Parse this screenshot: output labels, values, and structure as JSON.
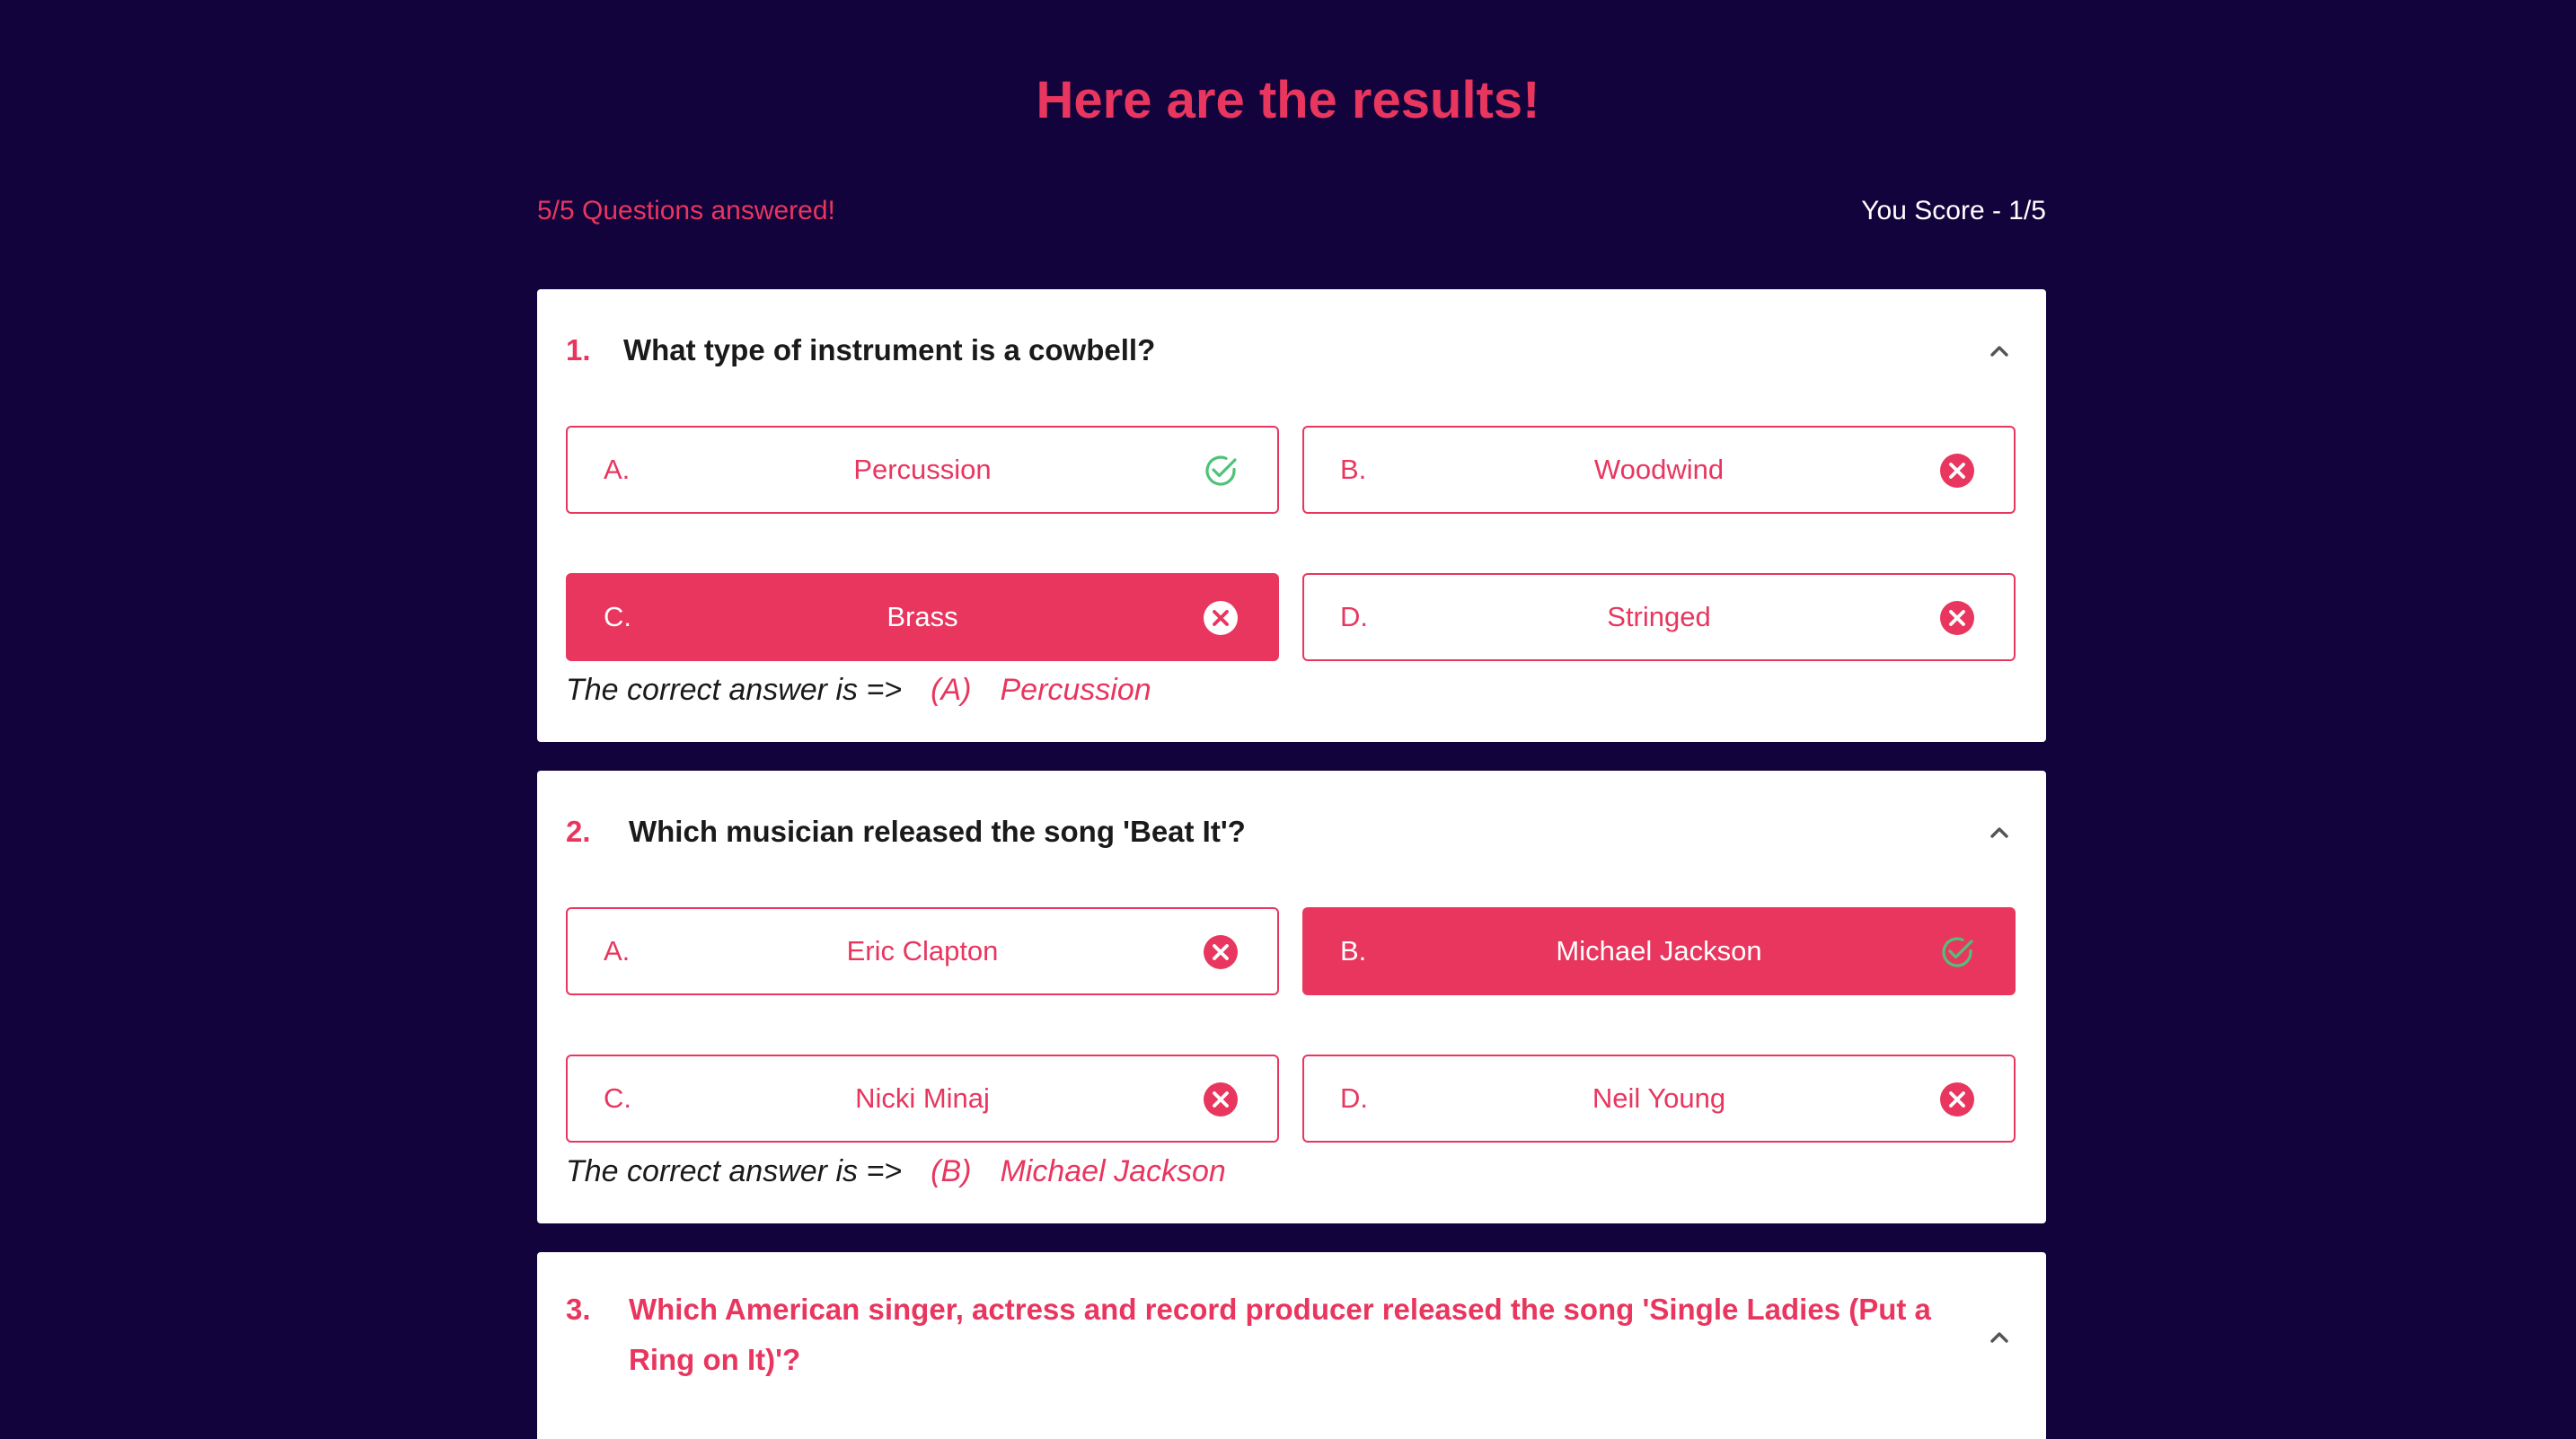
{
  "header": {
    "title": "Here are the results!",
    "answered": "5/5 Questions answered!",
    "score": "You Score - 1/5"
  },
  "colors": {
    "background": "#13033d",
    "accent": "#e8365f",
    "correct_icon": "#4fc27a",
    "card": "#ffffff"
  },
  "correct_prefix": "The correct answer is =>",
  "questions": [
    {
      "number": "1.",
      "text": "What type of instrument is a cowbell?",
      "options": [
        {
          "letter": "A.",
          "label": "Percussion",
          "icon": "check-circle-icon",
          "selected": false
        },
        {
          "letter": "B.",
          "label": "Woodwind",
          "icon": "x-circle-icon",
          "selected": false
        },
        {
          "letter": "C.",
          "label": "Brass",
          "icon": "x-circle-icon",
          "selected": true
        },
        {
          "letter": "D.",
          "label": "Stringed",
          "icon": "x-circle-icon",
          "selected": false
        }
      ],
      "correct_letter": "(A)",
      "correct_answer": "Percussion"
    },
    {
      "number": "2.",
      "text": "Which musician released the song 'Beat It'?",
      "options": [
        {
          "letter": "A.",
          "label": "Eric Clapton",
          "icon": "x-circle-icon",
          "selected": false
        },
        {
          "letter": "B.",
          "label": "Michael Jackson",
          "icon": "check-circle-icon",
          "selected": true
        },
        {
          "letter": "C.",
          "label": "Nicki Minaj",
          "icon": "x-circle-icon",
          "selected": false
        },
        {
          "letter": "D.",
          "label": "Neil Young",
          "icon": "x-circle-icon",
          "selected": false
        }
      ],
      "correct_letter": "(B)",
      "correct_answer": "Michael Jackson"
    },
    {
      "number": "3.",
      "text": "Which American singer, actress and record producer released the song 'Single Ladies (Put a Ring on It)'?"
    }
  ]
}
